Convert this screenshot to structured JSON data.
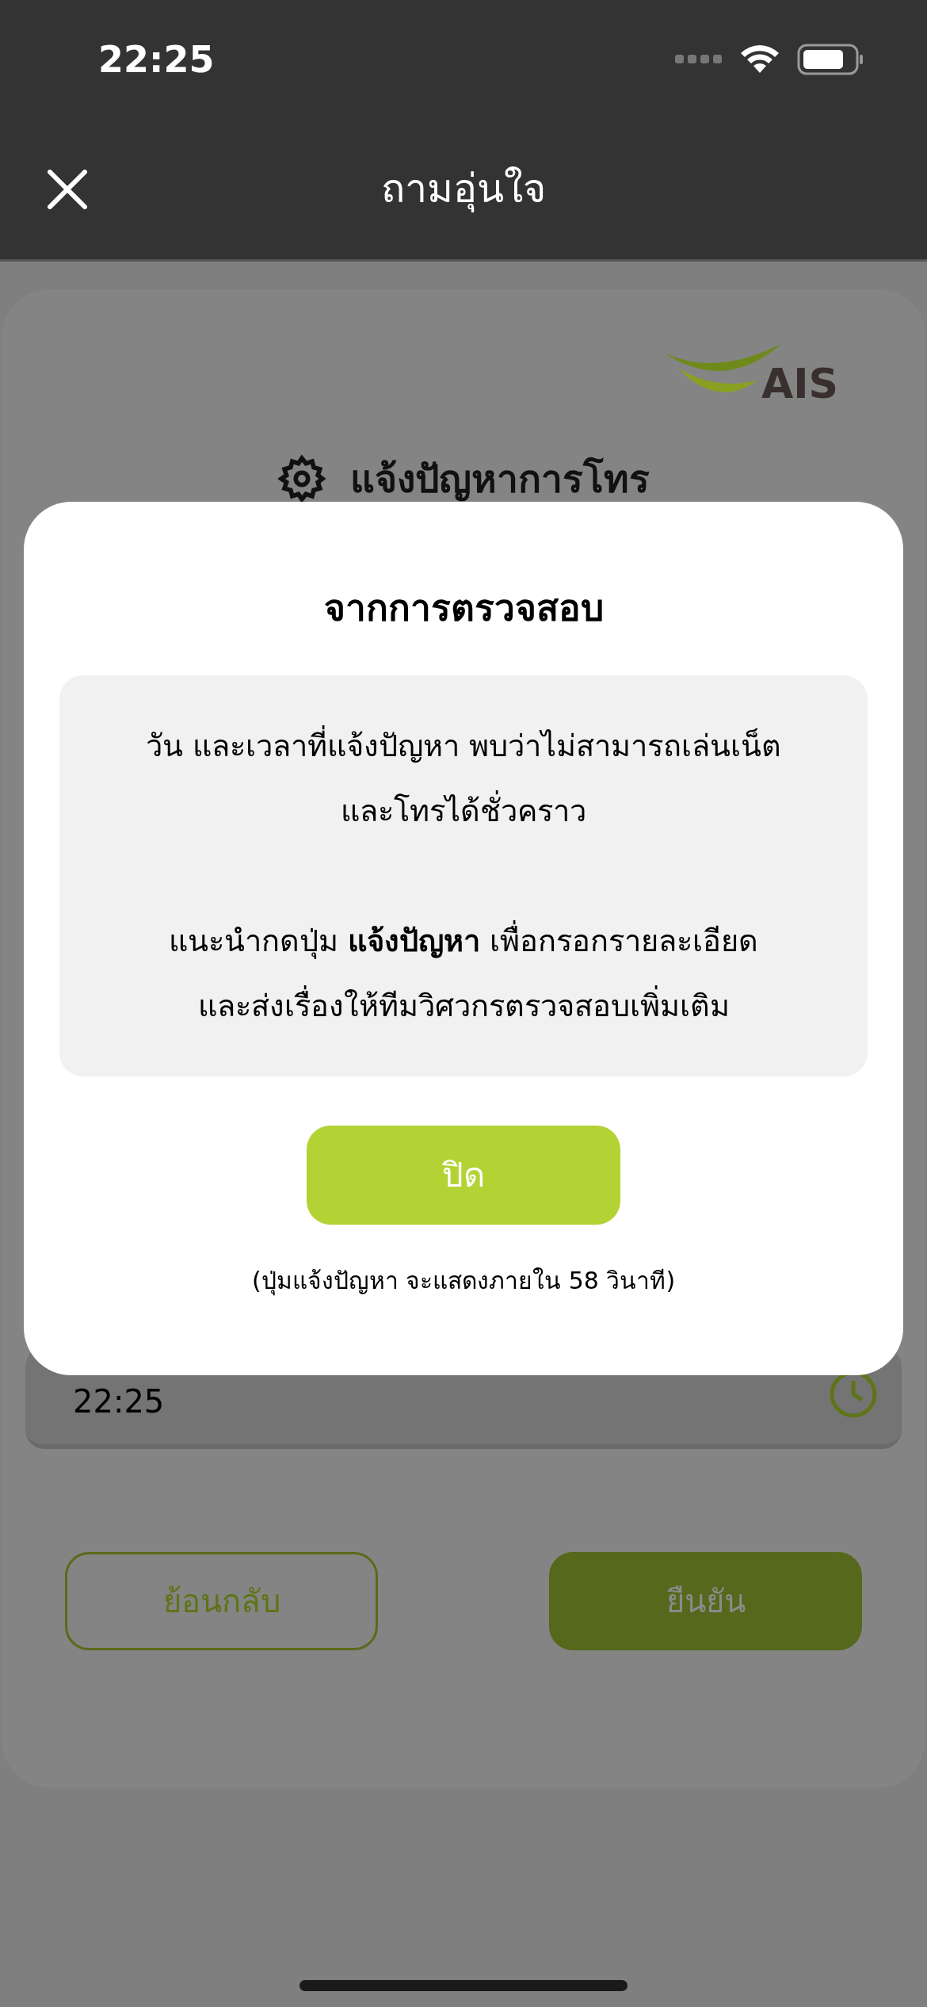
{
  "status_bar": {
    "time": "22:25"
  },
  "header": {
    "title": "ถามอุ่นใจ"
  },
  "page": {
    "brand": "AIS",
    "title": "แจ้งปัญหาการโทร",
    "time_field": {
      "value": "22:25"
    },
    "buttons": [
      {
        "label": "ย้อนกลับ",
        "kind": "outline"
      },
      {
        "label": "ยืนยัน",
        "kind": "filled"
      }
    ]
  },
  "dialog": {
    "title": "จากการตรวจสอบ",
    "paragraphs": [
      {
        "lines": [
          "วัน และเวลาที่แจ้งปัญหา พบว่าไม่สามารถเล่นเน็ต",
          "และโทรได้ชั่วคราว"
        ]
      },
      {
        "lines": [
          "แนะนำกดปุ่ม **แจ้งปัญหา** เพื่อกรอกรายละเอียด",
          "และส่งเรื่องให้ทีมวิศวกรตรวจสอบเพิ่มเติม"
        ]
      }
    ],
    "button": "ปิด",
    "note": "(ปุ่มแจ้งปัญหา จะแสดงภายใน 58 วินาที)"
  }
}
